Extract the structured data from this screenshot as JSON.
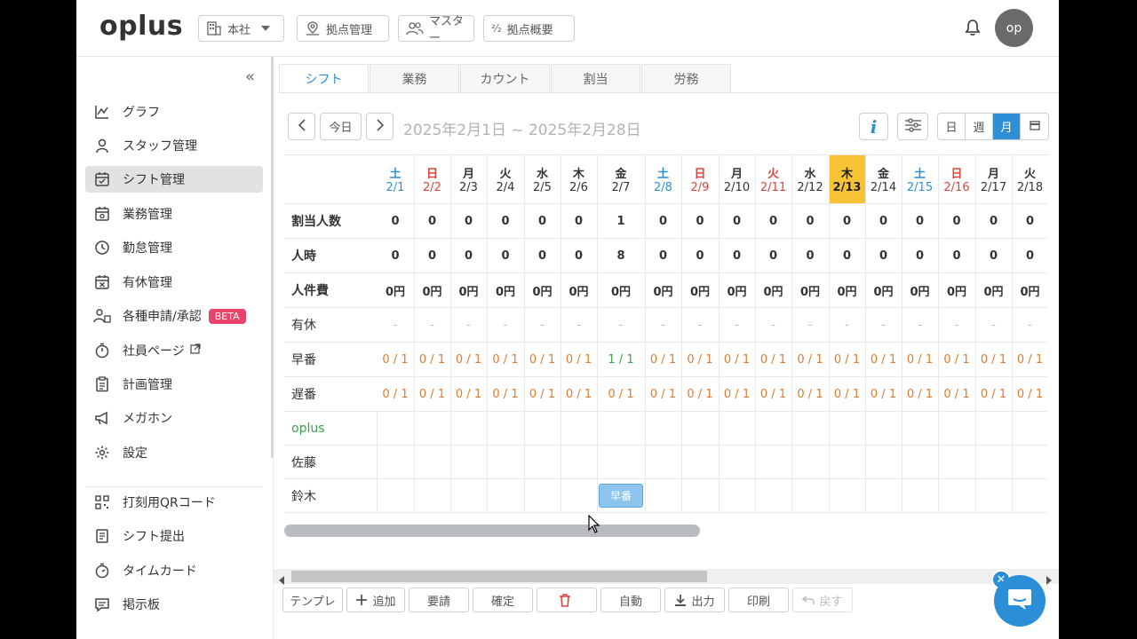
{
  "header": {
    "logo": "oplus",
    "buttons": [
      {
        "label": "本社",
        "icon": "building-icon"
      },
      {
        "label": "拠点管理",
        "icon": "map-pin-icon"
      },
      {
        "label": "マスター",
        "icon": "users-icon"
      },
      {
        "label": "拠点概要",
        "icon": "fraction-icon"
      }
    ],
    "avatar": "op"
  },
  "sidebar": {
    "items": [
      {
        "label": "グラフ",
        "icon": "chart-icon"
      },
      {
        "label": "スタッフ管理",
        "icon": "person-icon"
      },
      {
        "label": "シフト管理",
        "icon": "calendar-check-icon"
      },
      {
        "label": "業務管理",
        "icon": "calendar-task-icon"
      },
      {
        "label": "勤怠管理",
        "icon": "clock-icon"
      },
      {
        "label": "有休管理",
        "icon": "calendar-x-icon"
      },
      {
        "label": "各種申請/承認",
        "icon": "people-icon",
        "badge": "BETA"
      },
      {
        "label": "社員ページ",
        "icon": "stopwatch-icon"
      },
      {
        "label": "計画管理",
        "icon": "clipboard-icon"
      },
      {
        "label": "メガホン",
        "icon": "megaphone-icon"
      },
      {
        "label": "設定",
        "icon": "gear-icon"
      }
    ],
    "items2": [
      {
        "label": "打刻用QRコード",
        "icon": "qr-icon"
      },
      {
        "label": "シフト提出",
        "icon": "document-icon"
      },
      {
        "label": "タイムカード",
        "icon": "timer-icon"
      },
      {
        "label": "掲示板",
        "icon": "board-icon"
      }
    ]
  },
  "tabs": [
    "シフト",
    "業務",
    "カウント",
    "割当",
    "労務"
  ],
  "nav": {
    "today": "今日",
    "range": "2025年2月1日 ~ 2025年2月28日",
    "views": [
      "日",
      "週",
      "月"
    ]
  },
  "grid": {
    "days": [
      {
        "dow": "土",
        "date": "2/1",
        "type": "sat"
      },
      {
        "dow": "日",
        "date": "2/2",
        "type": "sun"
      },
      {
        "dow": "月",
        "date": "2/3",
        "type": ""
      },
      {
        "dow": "火",
        "date": "2/4",
        "type": ""
      },
      {
        "dow": "水",
        "date": "2/5",
        "type": ""
      },
      {
        "dow": "木",
        "date": "2/6",
        "type": ""
      },
      {
        "dow": "金",
        "date": "2/7",
        "type": ""
      },
      {
        "dow": "土",
        "date": "2/8",
        "type": "sat"
      },
      {
        "dow": "日",
        "date": "2/9",
        "type": "sun"
      },
      {
        "dow": "月",
        "date": "2/10",
        "type": ""
      },
      {
        "dow": "火",
        "date": "2/11",
        "type": "sun"
      },
      {
        "dow": "水",
        "date": "2/12",
        "type": ""
      },
      {
        "dow": "木",
        "date": "2/13",
        "type": "today"
      },
      {
        "dow": "金",
        "date": "2/14",
        "type": ""
      },
      {
        "dow": "土",
        "date": "2/15",
        "type": "sat"
      },
      {
        "dow": "日",
        "date": "2/16",
        "type": "sun"
      },
      {
        "dow": "月",
        "date": "2/17",
        "type": ""
      },
      {
        "dow": "火",
        "date": "2/18",
        "type": ""
      }
    ],
    "rows": [
      {
        "label": "割当人数",
        "bold": true,
        "values": [
          "0",
          "0",
          "0",
          "0",
          "0",
          "0",
          "1",
          "0",
          "0",
          "0",
          "0",
          "0",
          "0",
          "0",
          "0",
          "0",
          "0",
          "0"
        ]
      },
      {
        "label": "人時",
        "bold": true,
        "values": [
          "0",
          "0",
          "0",
          "0",
          "0",
          "0",
          "8",
          "0",
          "0",
          "0",
          "0",
          "0",
          "0",
          "0",
          "0",
          "0",
          "0",
          "0"
        ]
      },
      {
        "label": "人件費",
        "bold": true,
        "values": [
          "0円",
          "0円",
          "0円",
          "0円",
          "0円",
          "0円",
          "0円",
          "0円",
          "0円",
          "0円",
          "0円",
          "0円",
          "0円",
          "0円",
          "0円",
          "0円",
          "0円",
          "0円"
        ]
      },
      {
        "label": "有休",
        "values": [
          "-",
          "-",
          "-",
          "-",
          "-",
          "-",
          "-",
          "-",
          "-",
          "-",
          "-",
          "-",
          "-",
          "-",
          "-",
          "-",
          "-",
          "-"
        ]
      },
      {
        "label": "早番",
        "values": [
          "0 / 1",
          "0 / 1",
          "0 / 1",
          "0 / 1",
          "0 / 1",
          "0 / 1",
          "1 / 1",
          "0 / 1",
          "0 / 1",
          "0 / 1",
          "0 / 1",
          "0 / 1",
          "0 / 1",
          "0 / 1",
          "0 / 1",
          "0 / 1",
          "0 / 1",
          "0 / 1"
        ]
      },
      {
        "label": "遅番",
        "values": [
          "0 / 1",
          "0 / 1",
          "0 / 1",
          "0 / 1",
          "0 / 1",
          "0 / 1",
          "0 / 1",
          "0 / 1",
          "0 / 1",
          "0 / 1",
          "0 / 1",
          "0 / 1",
          "0 / 1",
          "0 / 1",
          "0 / 1",
          "0 / 1",
          "0 / 1",
          "0 / 1"
        ]
      },
      {
        "label": "oplus",
        "green": true,
        "values": []
      },
      {
        "label": "佐藤",
        "values": []
      },
      {
        "label": "鈴木",
        "values": []
      }
    ],
    "shift_chip": {
      "row": 8,
      "day": 6,
      "label": "早番"
    }
  },
  "toolbar": [
    {
      "label": "テンプレ",
      "w": 68
    },
    {
      "label": "追加",
      "w": 66,
      "icon": "plus-icon"
    },
    {
      "label": "要請",
      "w": 68
    },
    {
      "label": "確定",
      "w": 68
    },
    {
      "label": "",
      "w": 68,
      "icon": "trash-icon"
    },
    {
      "label": "自動",
      "w": 68
    },
    {
      "label": "出力",
      "w": 68,
      "icon": "download-icon"
    },
    {
      "label": "印刷",
      "w": 68
    },
    {
      "label": "戻す",
      "w": 68,
      "icon": "undo-icon",
      "disabled": true
    }
  ],
  "colors": {
    "accent": "#2f8fd6",
    "saturday": "#2f8fd6",
    "sunday": "#e0433a",
    "today": "#f7c233",
    "short": "#e27a2f",
    "ok": "#3aa34a"
  }
}
